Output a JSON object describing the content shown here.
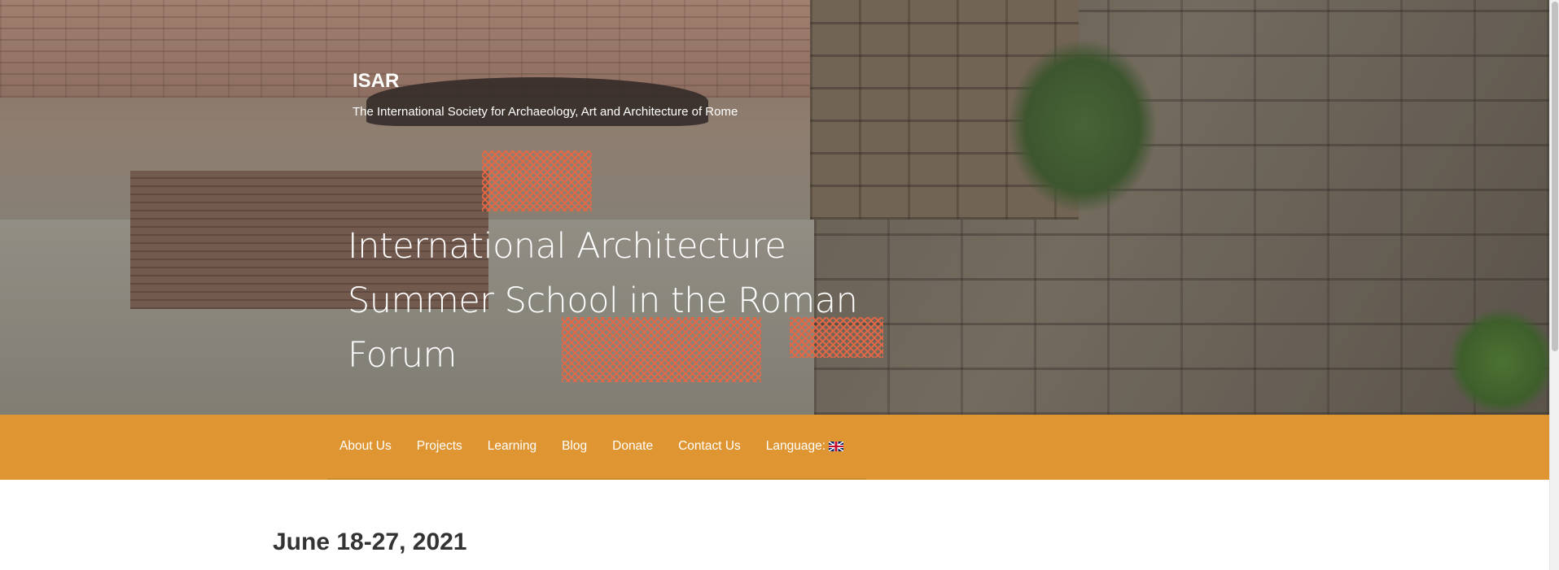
{
  "site": {
    "title": "ISAR",
    "tagline": "The International Society for Archaeology, Art and Architecture of Rome"
  },
  "hero": {
    "heading": "International Architecture Summer School in the Roman Forum",
    "image_icon": "excavation-photo"
  },
  "nav": {
    "items": [
      {
        "label": "About Us"
      },
      {
        "label": "Projects"
      },
      {
        "label": "Learning"
      },
      {
        "label": "Blog"
      },
      {
        "label": "Donate"
      },
      {
        "label": "Contact Us"
      },
      {
        "label": "Language:"
      }
    ],
    "language_icon": "uk-flag-icon",
    "color": "#df9632"
  },
  "content": {
    "date": "June 18-27, 2021"
  }
}
